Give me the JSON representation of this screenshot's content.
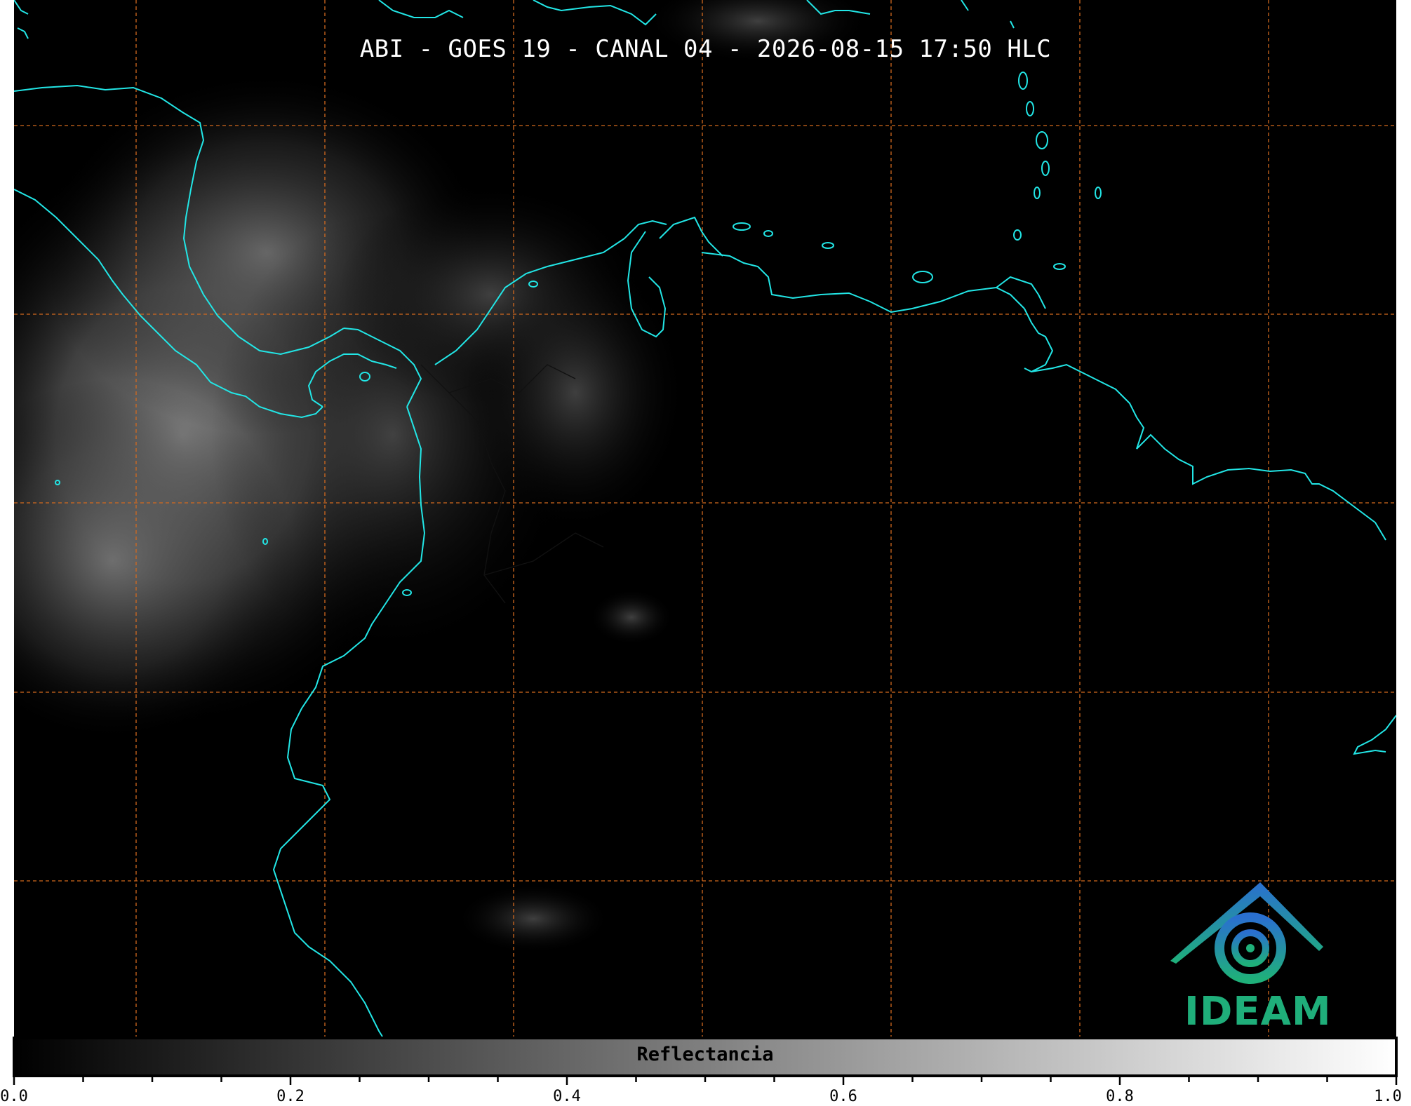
{
  "title": "ABI - GOES 19 - CANAL 04 - 2026-08-15 17:50 HLC",
  "colorbar": {
    "label": "Reflectancia",
    "ticks": [
      "0.0",
      "0.2",
      "0.4",
      "0.6",
      "0.8",
      "1.0"
    ],
    "range": [
      0.0,
      1.0
    ],
    "colormap": "greyscale black-to-white"
  },
  "logo": {
    "text": "IDEAM"
  },
  "colors": {
    "coastline": "#22e6e6",
    "gridline": "#d2691e",
    "background": "#000000"
  }
}
